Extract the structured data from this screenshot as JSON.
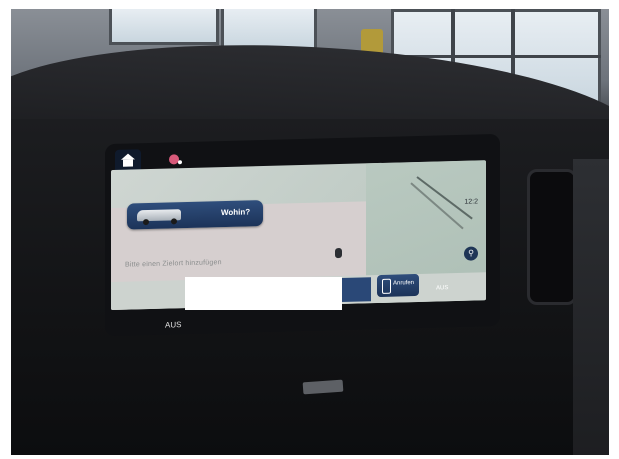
{
  "scene": {
    "redaction_color": "#ffffff"
  },
  "infotainment": {
    "tabs": [
      {
        "icon": "home-icon"
      },
      {
        "icon": "navigation-pin-icon"
      }
    ],
    "status_time": "12:2",
    "destination_button": {
      "label": "Wohin?",
      "icon": "van-icon"
    },
    "map_text": "Bitte einen Zielort hinzufügen",
    "zoom_icon": "magnifier-icon",
    "bottom": {
      "call_button": {
        "label": "Anrufen",
        "icon": "phone-icon"
      },
      "right_label": "AUS"
    },
    "climate_left_label": "AUS"
  },
  "colors": {
    "screen_blue": "#1c3359",
    "nav_pin": "#d85a7a"
  }
}
